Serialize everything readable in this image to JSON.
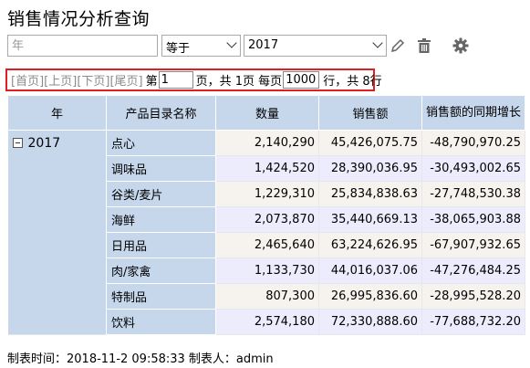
{
  "title": "销售情况分析查询",
  "filter": {
    "field_placeholder": "年",
    "operator": "等于",
    "value": "2017",
    "icons": [
      "edit-icon",
      "trash-icon",
      "gear-icon"
    ]
  },
  "pager": {
    "first": "[首页]",
    "prev": "[上页]",
    "next": "[下页]",
    "last": "[尾页]",
    "page_prefix": "第",
    "page_value": "1",
    "page_suffix": "页，共 1页 每页",
    "per_page_value": "1000",
    "rows_text": "行，共 8行"
  },
  "table": {
    "headers": [
      "年",
      "产品目录名称",
      "数量",
      "销售额",
      "销售额的同期增长"
    ],
    "year": "2017",
    "rows": [
      {
        "cat": "点心",
        "qty": "2,140,290",
        "sales": "45,426,075.75",
        "growth": "-48,790,970.25"
      },
      {
        "cat": "调味品",
        "qty": "1,424,520",
        "sales": "28,390,036.95",
        "growth": "-30,493,002.65"
      },
      {
        "cat": "谷类/麦片",
        "qty": "1,229,310",
        "sales": "25,834,838.63",
        "growth": "-27,748,530.38"
      },
      {
        "cat": "海鲜",
        "qty": "2,073,870",
        "sales": "35,440,669.13",
        "growth": "-38,065,903.88"
      },
      {
        "cat": "日用品",
        "qty": "2,465,640",
        "sales": "63,224,626.95",
        "growth": "-67,907,932.65"
      },
      {
        "cat": "肉/家禽",
        "qty": "1,133,730",
        "sales": "44,016,037.06",
        "growth": "-47,276,484.25"
      },
      {
        "cat": "特制品",
        "qty": "807,300",
        "sales": "26,995,836.60",
        "growth": "-28,995,528.20"
      },
      {
        "cat": "饮料",
        "qty": "2,574,180",
        "sales": "72,330,888.60",
        "growth": "-77,688,732.20"
      }
    ]
  },
  "footer": "制表时间：2018-11-2 09:58:33 制表人：admin"
}
